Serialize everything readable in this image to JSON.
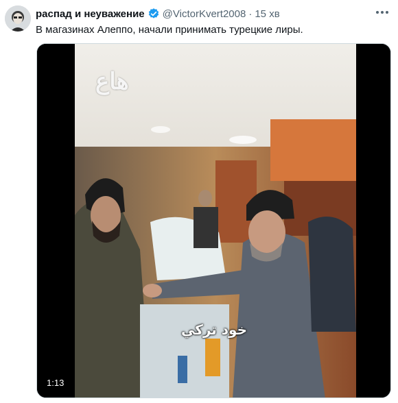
{
  "author": {
    "name": "распад и неуважение",
    "handle": "@VictorKvert2008",
    "separator": "·",
    "time": "15 хв",
    "verified_icon": "verified-badge-icon",
    "verified_color": "#1d9bf0"
  },
  "tweet_text": "В магазинах Алеппо, начали принимать турецкие лиры.",
  "media": {
    "duration": "1:13",
    "caption": "خود تركي",
    "watermark": "هاع"
  },
  "more_icon": "more-dots-icon"
}
